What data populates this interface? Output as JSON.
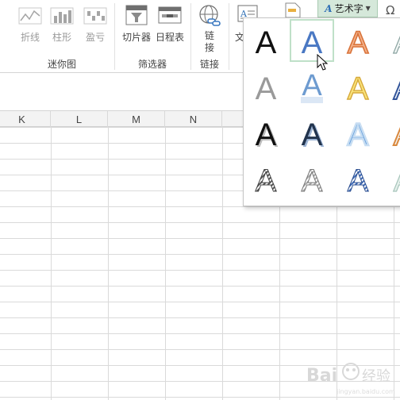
{
  "ribbon": {
    "cut_label": "",
    "sparklines": {
      "line_label": "折线",
      "column_label": "柱形",
      "winloss_label": "盈亏",
      "group_label": "迷你图"
    },
    "filters": {
      "slicer_label": "切片器",
      "timeline_label": "日程表",
      "group_label": "筛选器"
    },
    "links": {
      "link_label": "链接",
      "group_label": "链接"
    },
    "text": {
      "textbox_label": "文",
      "wordart_label": "艺术字",
      "wordart_icon": "A"
    }
  },
  "columns": [
    "K",
    "L",
    "M",
    "N"
  ],
  "wordart_gallery": {
    "glyph": "A",
    "selected_index": 1,
    "styles": [
      {
        "name": "black-fill",
        "fill": "#111111"
      },
      {
        "name": "blue-outline",
        "fill": "#4a78c3"
      },
      {
        "name": "orange-gradient",
        "fill": "#f0a070"
      },
      {
        "name": "light-outline",
        "fill": "#e8f0ee"
      },
      {
        "name": "gray-shadow",
        "fill": "#999999"
      },
      {
        "name": "blue-reflection",
        "fill": "#5d8fc6"
      },
      {
        "name": "gold-outline",
        "fill": "#f7dd6a"
      },
      {
        "name": "blue-bevel",
        "fill": "#e9eef7"
      },
      {
        "name": "black-outline-shadow",
        "fill": "#111111"
      },
      {
        "name": "dark-blue-shadow",
        "fill": "#22344e"
      },
      {
        "name": "blue-glow",
        "fill": "#5e97d6"
      },
      {
        "name": "orange-glow",
        "fill": "#e8a070"
      },
      {
        "name": "striped-gray",
        "fill": "#777777"
      },
      {
        "name": "striped-light",
        "fill": "#aaaaaa"
      },
      {
        "name": "striped-blue",
        "fill": "#4a78c3"
      },
      {
        "name": "faint-green",
        "fill": "#cfe2dc"
      }
    ]
  },
  "watermark": {
    "text": "Bai 经验"
  }
}
